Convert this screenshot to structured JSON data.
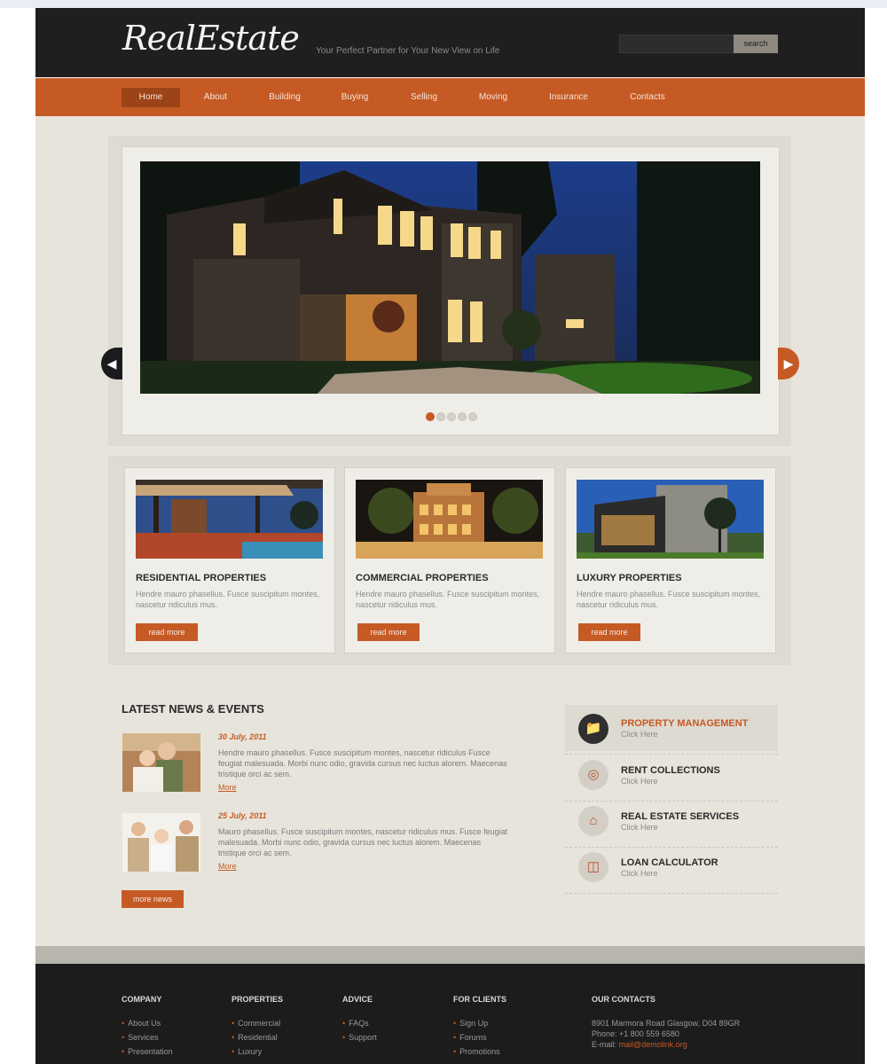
{
  "header": {
    "logo": "RealEstate",
    "tagline": "Your Perfect Partner for Your New View on Life",
    "search_button": "search"
  },
  "nav": {
    "items": [
      "Home",
      "About",
      "Building",
      "Buying",
      "Selling",
      "Moving",
      "Insurance",
      "Contacts"
    ],
    "active": "Home"
  },
  "slider": {
    "slide_count": 5,
    "active_slide": 1
  },
  "features": [
    {
      "title": "RESIDENTIAL PROPERTIES",
      "text": "Hendre mauro phasellus. Fusce suscipitum montes, nascetur ridiculus mus.",
      "button": "read more"
    },
    {
      "title": "COMMERCIAL PROPERTIES",
      "text": "Hendre mauro phasellus. Fusce suscipitum montes, nascetur ridiculus mus.",
      "button": "read more"
    },
    {
      "title": "LUXURY PROPERTIES",
      "text": "Hendre mauro phasellus. Fusce suscipitum montes, nascetur ridiculus mus.",
      "button": "read more"
    }
  ],
  "news": {
    "title": "LATEST NEWS & EVENTS",
    "items": [
      {
        "date": "30 July, 2011",
        "text": "Hendre mauro phasellus. Fusce suscipitum montes, nascetur ridiculus Fusce feugiat malesuada. Morbi nunc odio, gravida cursus nec luctus alorem. Maecenas tristique orci ac sem.",
        "more": "More"
      },
      {
        "date": "25 July, 2011",
        "text": "Mauro phasellus. Fusce suscipitum montes, nascetur ridiculus mus. Fusce feugiat malesuada. Morbi nunc odio, gravida cursus nec luctus alorem. Maecenas tristique orci ac sem.",
        "more": "More"
      }
    ],
    "more_button": "more news"
  },
  "services": [
    {
      "title": "PROPERTY MANAGEMENT",
      "sub": "Click Here",
      "icon": "folder-icon",
      "active": true
    },
    {
      "title": "RENT COLLECTIONS",
      "sub": "Click Here",
      "icon": "coins-icon",
      "active": false
    },
    {
      "title": "REAL ESTATE SERVICES",
      "sub": "Click Here",
      "icon": "house-icon",
      "active": false
    },
    {
      "title": "LOAN CALCULATOR",
      "sub": "Click Here",
      "icon": "calculator-icon",
      "active": false
    }
  ],
  "footer": {
    "columns": [
      {
        "head": "COMPANY",
        "links": [
          "About Us",
          "Services",
          "Presentation"
        ]
      },
      {
        "head": "PROPERTIES",
        "links": [
          "Commercial",
          "Residential",
          "Luxury"
        ]
      },
      {
        "head": "ADVICE",
        "links": [
          "FAQs",
          "Support"
        ]
      },
      {
        "head": "FOR CLIENTS",
        "links": [
          "Sign Up",
          "Forums",
          "Promotions"
        ]
      }
    ],
    "contacts_head": "OUR CONTACTS",
    "address": "8901 Marmora Road Glasgow, D04 89GR",
    "phone": "Phone: +1 800 559 6580",
    "email_label": "E-mail:",
    "email": "mail@demolink.org"
  },
  "colors": {
    "accent": "#c65a24",
    "header_bg": "#1f1f1f",
    "page_bg": "#e7e4dc"
  }
}
